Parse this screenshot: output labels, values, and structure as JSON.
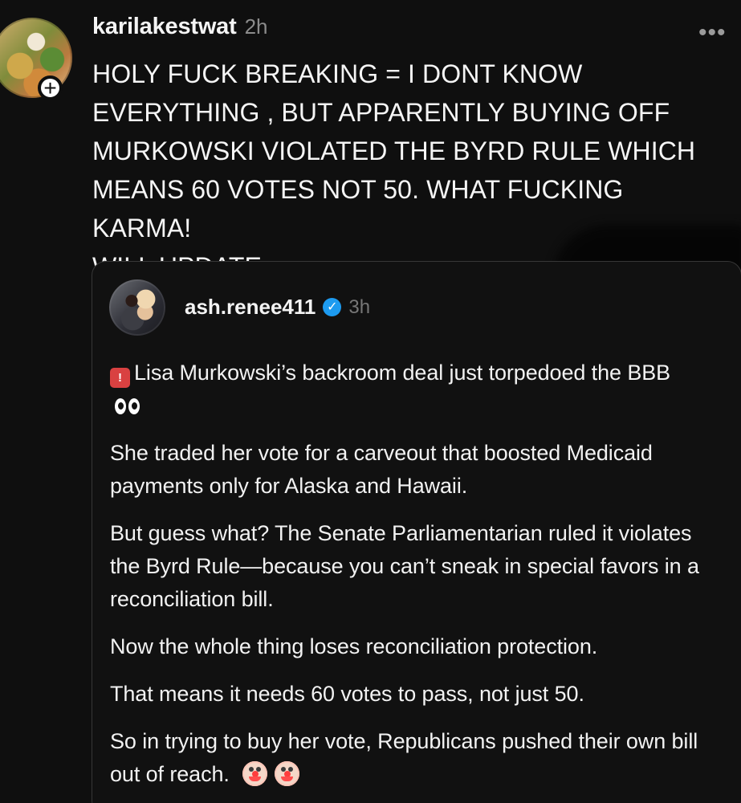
{
  "post": {
    "username": "karilakestwat",
    "time": "2h",
    "main_text": "HOLY FUCK BREAKING = I DONT KNOW\nEVERYTHING , BUT APPARENTLY BUYING OFF\nMURKOWSKI VIOLATED THE BYRD RULE WHICH\nMEANS 60 VOTES NOT 50. WHAT FUCKING KARMA!\nWILL UPDATE",
    "more_label": "•••",
    "follow_label": "+"
  },
  "quote": {
    "username": "ash.renee411",
    "time": "3h",
    "paragraphs": [
      "Lisa Murkowski’s backroom deal just torpedoed the BBB",
      "She traded her vote for a carveout that boosted Medicaid payments only for Alaska and Hawaii.",
      "But guess what? The Senate Parliamentarian ruled it violates the Byrd Rule—because you can’t sneak in special favors in a reconciliation bill.",
      "Now the whole thing loses reconciliation protection.",
      "That means it needs 60 votes to pass, not just 50.",
      "So in trying to buy her vote, Republicans pushed their own bill out of reach."
    ]
  },
  "icons": {
    "more": "more-icon",
    "follow": "plus-icon",
    "verified": "verified-icon",
    "siren": "siren-icon",
    "eyes": "eyes-icon",
    "clown": "clown-icon"
  },
  "colors": {
    "background": "#0f0f0f",
    "card_border": "#373737",
    "text": "#f3f3f3",
    "secondary_text": "#8c8c8c",
    "verified": "#1d9bf0"
  }
}
